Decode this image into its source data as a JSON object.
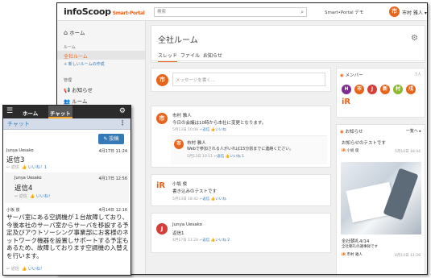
{
  "topbar": {
    "logo_main": "infoScoop",
    "logo_sub": "Smart-Portal",
    "search_placeholder": "検索",
    "portal_label": "Smart•Portal デモ",
    "user_initial": "市",
    "user_name": "市村 雅人 ▾"
  },
  "sidebar": {
    "home": "ホーム",
    "rooms_heading": "ルーム",
    "room_active": "全社ルーム",
    "new_room": "+ 新しいルームの作成",
    "admin_heading": "管理",
    "notices": "お知らせ",
    "rooms": "ルーム"
  },
  "room": {
    "title": "全社ルーム",
    "tabs": [
      "スレッド",
      "ファイル",
      "お知らせ"
    ],
    "message_placeholder": "メッセージを書く..."
  },
  "posts": [
    {
      "initial": "市",
      "author": "市村 雅人",
      "body": "今日の会議は10時から本社に変更となります。",
      "time": "5月13日 10:08",
      "reply": "返信",
      "like": "いいね"
    },
    {
      "initial": "市",
      "author": "市村 雅人",
      "body": "Webで参加される人がいれば15分前までに連絡ください。",
      "time": "5月13日 10:11",
      "reply": "返信",
      "like": "いいね",
      "like_count": "1"
    },
    {
      "author": "小坂 俊",
      "body": "書き込みのテストです",
      "time": "5月13日 18:42",
      "reply": "返信",
      "like": "いいね"
    },
    {
      "initial": "J",
      "author": "Junya Uesako",
      "body": "返信1",
      "time": "4月17日 11:24",
      "reply": "返信",
      "like": "いいね",
      "like_count": "2"
    }
  ],
  "members": {
    "title": "メンバー",
    "count": "7人",
    "avatars": [
      "H",
      "市",
      "J",
      "新",
      "村",
      "戌"
    ]
  },
  "notices": {
    "title": "お知らせ",
    "more": "一覧へ ▸",
    "item1": "お知らせのテストです",
    "item1_author": "小坂 俊",
    "item1_date": "5月10日 18:44",
    "item2_title": "全社朝礼4/14",
    "item2_desc": "全社朝礼の議事録です",
    "item2_author": "市村 雅人",
    "item2_date": "4月14日 11:28"
  },
  "mobile": {
    "tabs": [
      "ホーム",
      "チャット"
    ],
    "header": "チャット",
    "post_btn": "✎ 投稿",
    "items": [
      {
        "author": "Junya Uesako",
        "date": "4月17日 11:24",
        "body": "返信3",
        "reply": "返信",
        "like": "いいね！1"
      },
      {
        "author": "Junya Uesako",
        "date": "4月17日 12:56",
        "body": "返信4",
        "reply": "返信",
        "like": "いいね！"
      },
      {
        "author": "小坂 俊",
        "date": "4月14日 12:16",
        "body": "サーバ室にある空調機が１台故障しており、今後本社のサーバ室からサーバを移設する予定及びアウトソーシング事業部にお客様のネットワーク機器を設置しサポートする予定もあるため、故障しております空調機の入替えを行います。",
        "reply": "返信",
        "like": "いいね！"
      }
    ]
  },
  "colors": {
    "accent": "#e8641b",
    "link": "#337ab7",
    "mobile_header": "#d4dcea",
    "nav_dark": "#2b2b2b"
  }
}
